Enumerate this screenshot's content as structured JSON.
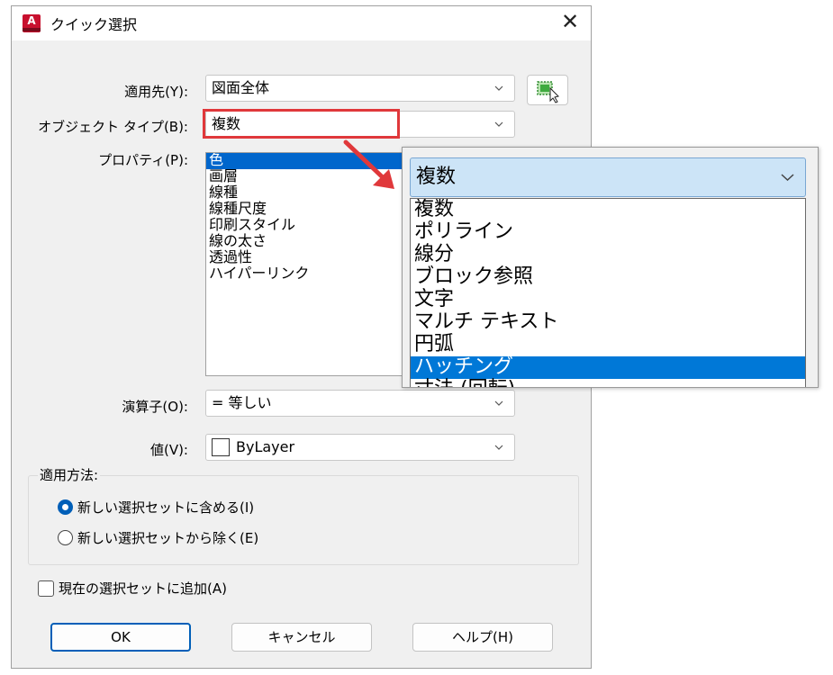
{
  "window": {
    "title": "クイック選択",
    "close_glyph": "✕",
    "app_icon_letter": "A"
  },
  "form": {
    "apply_to": {
      "label": "適用先(Y):",
      "value": "図面全体"
    },
    "object_type": {
      "label": "オブジェクト タイプ(B):",
      "value": "複数"
    },
    "properties": {
      "label": "プロパティ(P):",
      "items": [
        "色",
        "画層",
        "線種",
        "線種尺度",
        "印刷スタイル",
        "線の太さ",
        "透過性",
        "ハイパーリンク"
      ],
      "selected_index": 0
    },
    "operator": {
      "label": "演算子(O):",
      "value": "= 等しい"
    },
    "value": {
      "label": "値(V):",
      "value": "ByLayer"
    }
  },
  "apply_method": {
    "label": "適用方法:",
    "options": [
      {
        "label": "新しい選択セットに含める(I)",
        "checked": true
      },
      {
        "label": "新しい選択セットから除く(E)",
        "checked": false
      }
    ]
  },
  "append": {
    "label": "現在の選択セットに追加(A)",
    "checked": false
  },
  "buttons": {
    "ok": "OK",
    "cancel": "キャンセル",
    "help": "ヘルプ(H)"
  },
  "dropdown_popup": {
    "value": "複数",
    "items": [
      "複数",
      "ポリライン",
      "線分",
      "ブロック参照",
      "文字",
      "マルチ テキスト",
      "円弧",
      "ハッチング",
      "寸法 (回転)"
    ],
    "selected_index": 7
  },
  "colors": {
    "accent": "#0078d7",
    "highlight_box": "#e0383b",
    "arrow": "#e0383b"
  }
}
